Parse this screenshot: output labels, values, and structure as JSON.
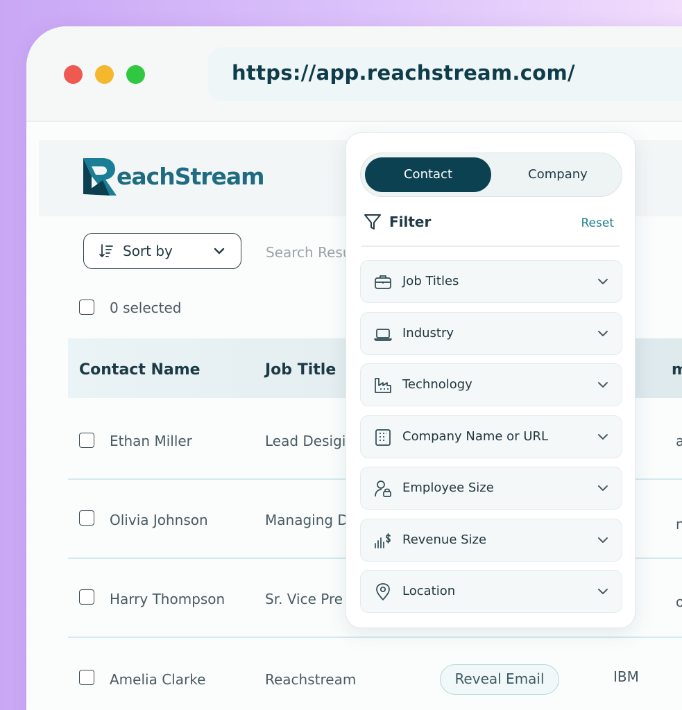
{
  "browser": {
    "url": "https://app.reachstream.com/",
    "controls": {
      "close_color": "#ee5a52",
      "minimize_color": "#f5b82c",
      "maximize_color": "#2fc840"
    }
  },
  "app": {
    "logo_text": "eachStream",
    "logo_letter": "R",
    "sort_label": "Sort by",
    "search_placeholder": "Search Resu",
    "selected_count": "0 selected"
  },
  "table": {
    "columns": [
      "Contact Name",
      "Job Title",
      "mpany"
    ],
    "rows": [
      {
        "name": "Ethan Miller",
        "title": "Lead Desigi",
        "company": "azon"
      },
      {
        "name": "Olivia Johnson",
        "title": "Managing D",
        "company": "nap"
      },
      {
        "name": "Harry Thompson",
        "title": "Sr. Vice Pre",
        "company": "oro"
      },
      {
        "name": "Amelia Clarke",
        "title": "Reachstream",
        "action": "Reveal Email",
        "company": "IBM"
      }
    ]
  },
  "filter_panel": {
    "tabs": [
      "Contact",
      "Company"
    ],
    "active_tab": "Contact",
    "title": "Filter",
    "reset_label": "Reset",
    "items": [
      {
        "label": "Job Titles",
        "icon": "briefcase-icon"
      },
      {
        "label": "Industry",
        "icon": "laptop-icon"
      },
      {
        "label": "Technology",
        "icon": "factory-icon"
      },
      {
        "label": "Company Name or URL",
        "icon": "building-icon"
      },
      {
        "label": "Employee Size",
        "icon": "user-lock-icon"
      },
      {
        "label": "Revenue Size",
        "icon": "revenue-chart-icon"
      },
      {
        "label": "Location",
        "icon": "map-pin-icon"
      }
    ]
  },
  "colors": {
    "primary": "#0b4150",
    "accent": "#1f7f94",
    "background_gradient": "#c9a7f5"
  }
}
